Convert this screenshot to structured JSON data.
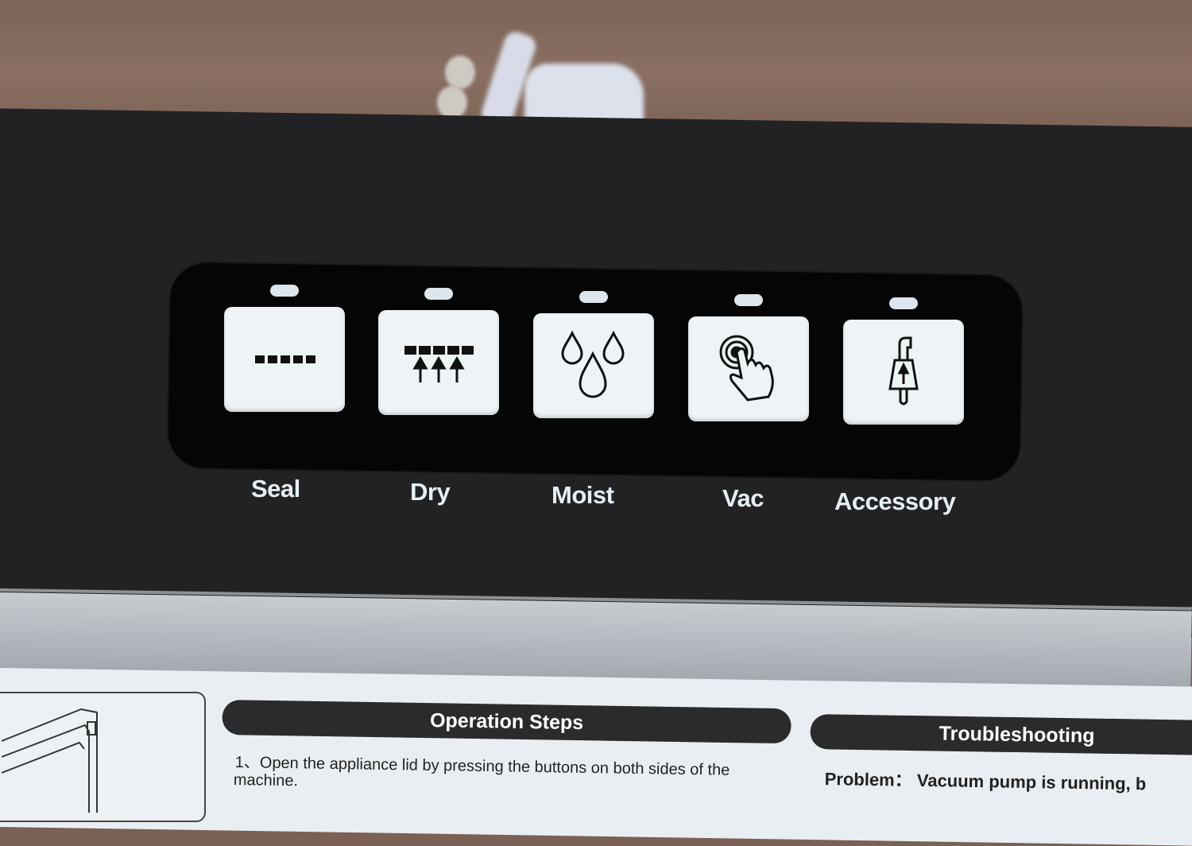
{
  "scene": {
    "description": "Vacuum sealer control panel photographed on a wooden table",
    "colors": {
      "panel": "#222224",
      "button_face": "#eef3f6",
      "label_text": "#e4eef4",
      "led": "#dde6ec",
      "paper": "#e9eef2",
      "section_bar": "#2b2b2e"
    }
  },
  "control_panel": {
    "buttons": [
      {
        "label": "Seal",
        "icon": "seal-dashes-icon"
      },
      {
        "label": "Dry",
        "icon": "dry-dashes-arrows-icon"
      },
      {
        "label": "Moist",
        "icon": "water-drops-icon"
      },
      {
        "label": "Vac",
        "icon": "hand-press-icon"
      },
      {
        "label": "Accessory",
        "icon": "accessory-hose-icon"
      }
    ]
  },
  "manual": {
    "operation_steps": {
      "title": "Operation Steps",
      "step_1_line_1": "1、Open the appliance lid by pressing the buttons on both sides of the",
      "step_1_line_2": "machine."
    },
    "troubleshooting": {
      "title": "Troubleshooting",
      "problem_label": "Problem：",
      "problem_text": "Vacuum pump is running, b"
    }
  }
}
